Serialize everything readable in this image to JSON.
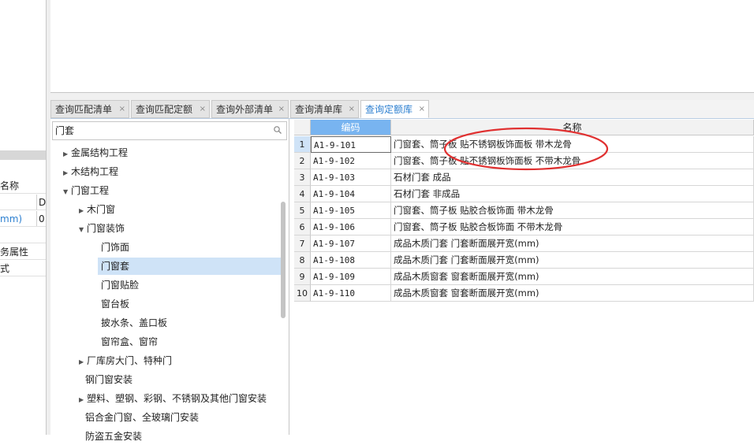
{
  "left_panel": {
    "rows": [
      {
        "text": "名称"
      },
      {
        "text": "",
        "col2": "DI"
      },
      {
        "text": "mm)",
        "col2": "0",
        "accent": true
      },
      {
        "text": ""
      },
      {
        "text": "务属性"
      },
      {
        "text": "式"
      }
    ]
  },
  "tabs": [
    {
      "label": "查询匹配清单",
      "close": "×"
    },
    {
      "label": "查询匹配定额",
      "close": "×"
    },
    {
      "label": "查询外部清单",
      "close": "×"
    },
    {
      "label": "查询清单库",
      "close": "×"
    },
    {
      "label": "查询定额库",
      "close": "×",
      "active": true
    }
  ],
  "search": {
    "value": "门套",
    "icon": "search-icon"
  },
  "tree": [
    {
      "label": "金属结构工程",
      "arrow": "▶"
    },
    {
      "label": "木结构工程",
      "arrow": "▶"
    },
    {
      "label": "门窗工程",
      "arrow": "▼"
    },
    {
      "label": "木门窗",
      "arrow": "▶"
    },
    {
      "label": "门窗装饰",
      "arrow": "▼"
    },
    {
      "label": "门饰面",
      "arrow": ""
    },
    {
      "label": "门窗套",
      "arrow": "",
      "selected": true
    },
    {
      "label": "门窗贴脸",
      "arrow": ""
    },
    {
      "label": "窗台板",
      "arrow": ""
    },
    {
      "label": "披水条、盖口板",
      "arrow": ""
    },
    {
      "label": "窗帘盒、窗帘",
      "arrow": ""
    },
    {
      "label": "厂库房大门、特种门",
      "arrow": "▶"
    },
    {
      "label": "钢门窗安装",
      "arrow": ""
    },
    {
      "label": "塑料、塑钢、彩钢、不锈钢及其他门窗安装",
      "arrow": "▶"
    },
    {
      "label": "铝合金门窗、全玻璃门安装",
      "arrow": ""
    },
    {
      "label": "防盗五金安装",
      "arrow": ""
    }
  ],
  "grid": {
    "headers": {
      "code": "编码",
      "name": "名称"
    },
    "rows": [
      {
        "num": "1",
        "code": "A1-9-101",
        "name": "门窗套、筒子板 贴不锈钢板饰面板 带木龙骨"
      },
      {
        "num": "2",
        "code": "A1-9-102",
        "name": "门窗套、筒子板 贴不锈钢板饰面板 不带木龙骨"
      },
      {
        "num": "3",
        "code": "A1-9-103",
        "name": "石材门套 成品"
      },
      {
        "num": "4",
        "code": "A1-9-104",
        "name": "石材门套 非成品"
      },
      {
        "num": "5",
        "code": "A1-9-105",
        "name": "门窗套、筒子板 贴胶合板饰面 带木龙骨"
      },
      {
        "num": "6",
        "code": "A1-9-106",
        "name": "门窗套、筒子板 贴胶合板饰面 不带木龙骨"
      },
      {
        "num": "7",
        "code": "A1-9-107",
        "name": "成品木质门套 门套断面展开宽(mm)"
      },
      {
        "num": "8",
        "code": "A1-9-108",
        "name": "成品木质门套 门套断面展开宽(mm)"
      },
      {
        "num": "9",
        "code": "A1-9-109",
        "name": "成品木质窗套 窗套断面展开宽(mm)"
      },
      {
        "num": "10",
        "code": "A1-9-110",
        "name": "成品木质窗套 窗套断面展开宽(mm)"
      }
    ]
  },
  "colors": {
    "accent": "#2c7fd0",
    "header_blue": "#78b4f0",
    "selection": "#cfe3f7",
    "annotation": "#e03030"
  }
}
